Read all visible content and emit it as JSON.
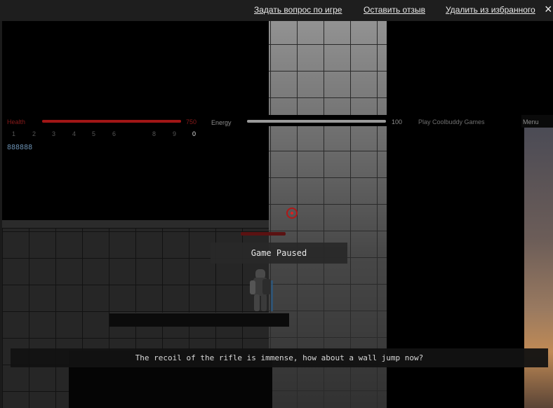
{
  "topbar": {
    "ask_question": "Задать вопрос по игре",
    "leave_review": "Оставить отзыв",
    "remove_favorite": "Удалить из избранного",
    "close_glyph": "×"
  },
  "hud": {
    "health_label": "Health",
    "health_value": "750",
    "health_fraction": 1.0,
    "energy_label": "Energy",
    "energy_value": "100",
    "energy_fraction": 1.0,
    "play_link": "Play Coolbuddy Games",
    "menu_label": "Menu",
    "weapon_slots": [
      "1",
      "2",
      "3",
      "4",
      "5",
      "6",
      "8",
      "9",
      "0"
    ],
    "active_slot": "0",
    "ammo": "888888"
  },
  "overlay": {
    "paused": "Game Paused",
    "message": "The recoil of the rifle is immense, how about a wall jump now?"
  },
  "icons": {
    "crosshair": "crosshair-icon",
    "close": "close-icon",
    "ammo": "ammo-icon"
  },
  "colors": {
    "health": "#a11616",
    "energy": "#9a9a9a",
    "crosshair": "#b01818",
    "ammo": "#6a8fb0"
  }
}
